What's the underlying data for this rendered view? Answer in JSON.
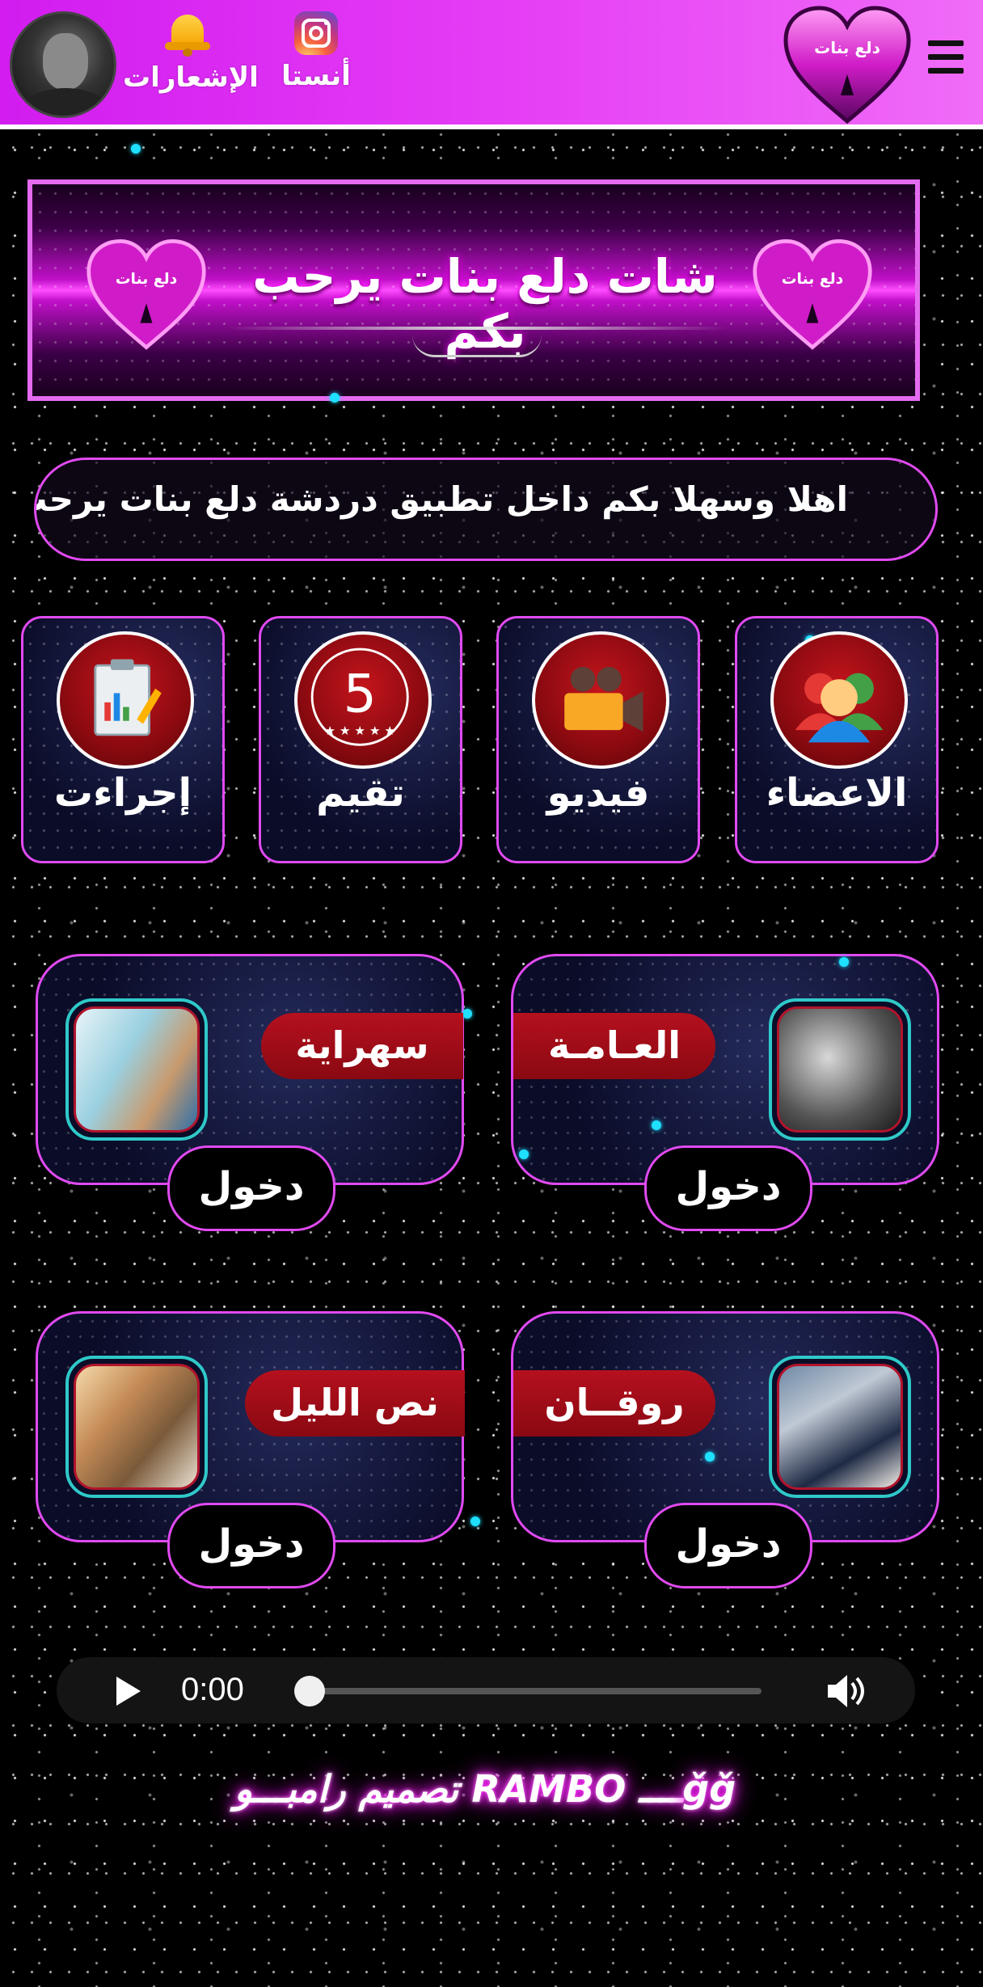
{
  "header": {
    "notifications_label": "الإشعارات",
    "instagram_label": "أنستا",
    "logo_text": "دلع بنات"
  },
  "banner": {
    "title": "شات دلع بنات يرحب بكم",
    "heart_text": "دلع بنات"
  },
  "marquee": {
    "text": "اهلا وسهلا بكم داخل تطبيق دردشة دلع بنات يرحب ب"
  },
  "tiles": [
    {
      "label": "الاعضاء",
      "icon": "users-icon"
    },
    {
      "label": "فيديو",
      "icon": "video-camera-icon"
    },
    {
      "label": "تقيم",
      "icon": "rating-5-icon",
      "badge": "5"
    },
    {
      "label": "إجراءت",
      "icon": "report-icon"
    }
  ],
  "rooms": [
    {
      "name": "العـامـة",
      "enter_label": "دخول"
    },
    {
      "name": "سهراية",
      "enter_label": "دخول"
    },
    {
      "name": "روقــان",
      "enter_label": "دخول"
    },
    {
      "name": "نص الليل",
      "enter_label": "دخول"
    }
  ],
  "audio": {
    "time": "0:00",
    "progress": 0
  },
  "signature": {
    "text": "تصميم رامبـــو RAMBO ــــǧǧ"
  },
  "colors": {
    "accent": "#e04af0",
    "header_bg": "#d21cf0",
    "ribbon": "#b5101e",
    "photo_border": "#2fc9c9"
  }
}
